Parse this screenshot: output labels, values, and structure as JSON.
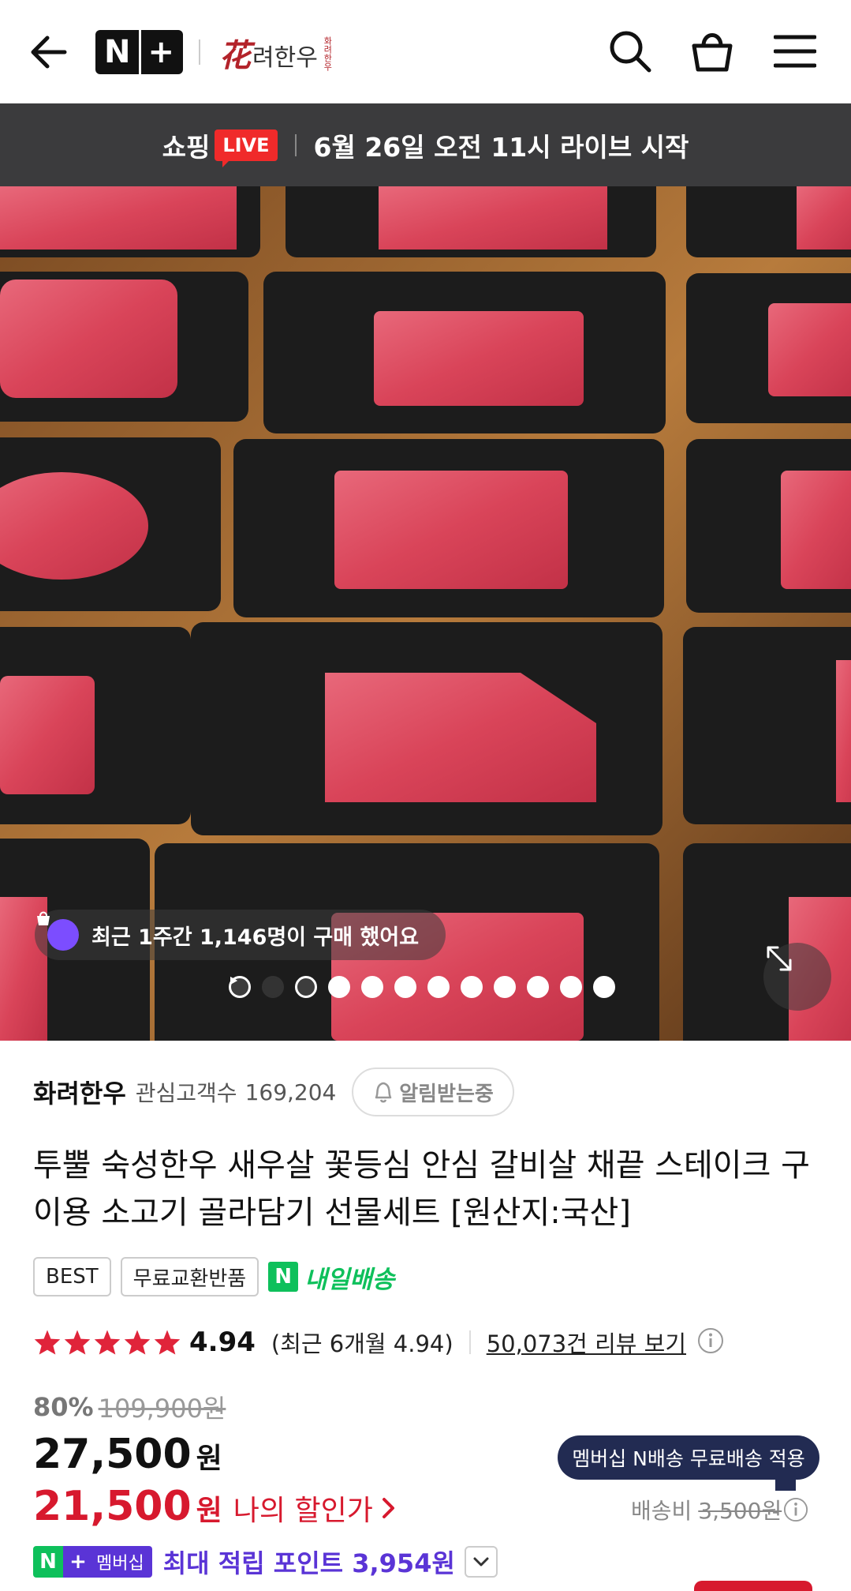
{
  "header": {
    "back_icon": "arrow-left-icon",
    "platform_logo_left": "N",
    "platform_logo_right": "+",
    "brand_logo_hanja": "花",
    "brand_logo_hangul": "려한우",
    "brand_logo_small": "화려한우",
    "icons": [
      "search-icon",
      "shopping-bag-icon",
      "hamburger-menu-icon"
    ]
  },
  "live_banner": {
    "shopping": "쇼핑",
    "live": "LIVE",
    "message": "6월 26일 오전 11시 라이브 시작"
  },
  "hero": {
    "purchase_notice": "최근 1주간 1,146명이 구매 했어요",
    "slides_total": 12,
    "active_slide": 2
  },
  "store": {
    "name": "화려한우",
    "fans_label": "관심고객수",
    "fans_count": "169,204",
    "alert_button": "알림받는중"
  },
  "product": {
    "title": "투뿔 숙성한우 새우살 꽃등심 안심 갈비살 채끝 스테이크 구이용 소고기 골라담기 선물세트 [원산지:국산]",
    "tags": [
      "BEST",
      "무료교환반품"
    ],
    "delivery_n": "N",
    "delivery_label": "내일배송"
  },
  "rating": {
    "stars": 5,
    "score": "4.94",
    "recent": "(최근 6개월 4.94)",
    "review_link": "50,073건 리뷰 보기"
  },
  "pricing": {
    "discount_rate": "80%",
    "original_price": "109,900원",
    "price": "27,500",
    "price_unit": "원",
    "my_price": "21,500",
    "my_price_unit": "원",
    "my_price_label": "나의 할인가",
    "membership_tip": "멤버십 N배송 무료배송 적용",
    "shipping_label": "배송비",
    "shipping_original": "3,500원",
    "badge_n": "N",
    "badge_plus": "+",
    "badge_membership": "멤버십",
    "points_text": "최대 적립 포인트 3,954원"
  },
  "colors": {
    "accent_red": "#d7192e",
    "naver_green": "#0ec05b",
    "membership_purple": "#5a34d6",
    "banner_dark": "#3b3b3d",
    "star_red": "#e0243a"
  }
}
